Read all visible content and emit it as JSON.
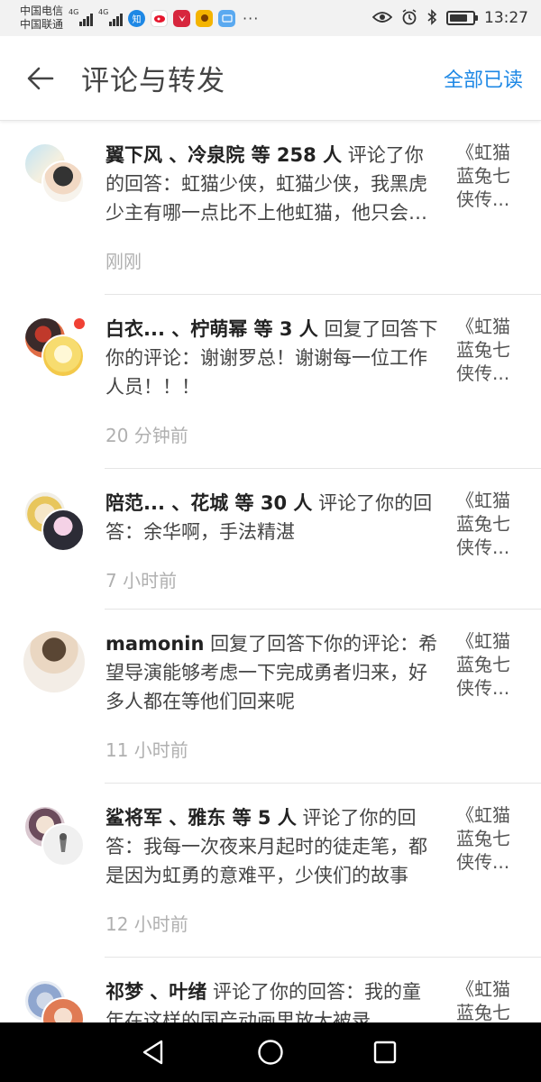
{
  "status_bar": {
    "carrier1": "中国电信",
    "carrier2": "中国联通",
    "net1": "4G",
    "net2": "4G",
    "time": "13:27",
    "app_icons": [
      "zhihu-icon",
      "weibo-icon",
      "huawei-icon",
      "game-icon",
      "card-icon"
    ],
    "app_icon_zhihu_label": "知",
    "dots": "···"
  },
  "header": {
    "title": "评论与转发",
    "mark_all_read": "全部已读"
  },
  "notifications": [
    {
      "names": "翼下风 、冷泉院 等 258 人",
      "action": " 评论了你的回答：虹猫少侠，虹猫少侠，我黑虎少主有哪一点比不上他虹猫，他只会舞刀弄剑，还会什么",
      "time": "刚刚",
      "source": "《虹猫蓝兔七侠传...",
      "unread": false
    },
    {
      "names": "白衣... 、柠萌幂 等 3 人",
      "action": " 回复了回答下你的评论：谢谢罗总！谢谢每一位工作人员！！！",
      "time": "20 分钟前",
      "source": "《虹猫蓝兔七侠传...",
      "unread": true
    },
    {
      "names": "陪范... 、花城 等 30 人",
      "action": " 评论了你的回答：余华啊，手法精湛",
      "time": "7 小时前",
      "source": "《虹猫蓝兔七侠传...",
      "unread": false
    },
    {
      "names": "mamonin",
      "action": " 回复了回答下你的评论：希望导演能够考虑一下完成勇者归来，好多人都在等他们回来呢",
      "time": "11 小时前",
      "source": "《虹猫蓝兔七侠传...",
      "unread": false
    },
    {
      "names": "鲨将军 、雅东 等 5 人",
      "action": " 评论了你的回答：我每一次夜来月起时的徒走笔，都是因为虹勇的意难平，少侠们的故事",
      "time": "12 小时前",
      "source": "《虹猫蓝兔七侠传...",
      "unread": false
    },
    {
      "names": "祁梦 、叶绪",
      "action": " 评论了你的回答：我的童年在这样的国产动画里放大被录",
      "time": "",
      "source": "《虹猫蓝兔七侠传...",
      "unread": false
    }
  ],
  "nav": {
    "back": "back-triangle-icon",
    "home": "home-circle-icon",
    "recents": "recents-square-icon"
  },
  "colors": {
    "accent": "#1e88e5",
    "unread_dot": "#f04134",
    "timestamp": "#b0b0b0"
  }
}
